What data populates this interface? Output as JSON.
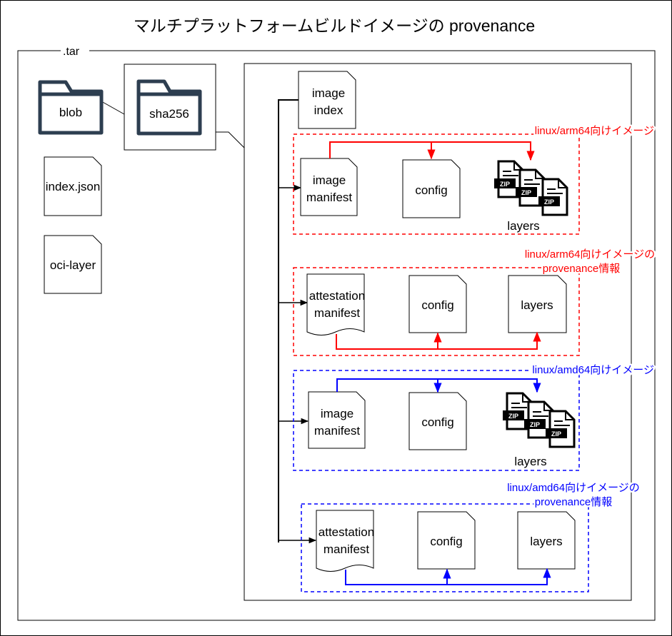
{
  "title": "マルチプラットフォームビルドイメージの provenance",
  "tar_label": ".tar",
  "colors": {
    "red": "#ff0000",
    "blue": "#0000ff",
    "black": "#000000",
    "folder": "#2d3e50"
  },
  "icons": {
    "folder": "folder-icon",
    "document": "document-icon",
    "zip": "zip-archive-icon"
  },
  "left": {
    "folders": [
      "blob",
      "sha256"
    ],
    "files": [
      "index.json",
      "oci-layer"
    ]
  },
  "image_index": {
    "line1": "image",
    "line2": "index"
  },
  "groups": [
    {
      "label": "linux/arm64向けイメージ",
      "color": "red",
      "manifest": {
        "line1": "image",
        "line2": "manifest"
      },
      "config": "config",
      "layers": "layers"
    },
    {
      "label": "linux/arm64向けイメージの",
      "label2": "provenance情報",
      "color": "red",
      "manifest": {
        "line1": "attestation",
        "line2": "manifest"
      },
      "config": "config",
      "layers": "layers"
    },
    {
      "label": "linux/amd64向けイメージ",
      "color": "blue",
      "manifest": {
        "line1": "image",
        "line2": "manifest"
      },
      "config": "config",
      "layers": "layers"
    },
    {
      "label": "linux/amd64向けイメージの",
      "label2": "provenance情報",
      "color": "blue",
      "manifest": {
        "line1": "attestation",
        "line2": "manifest"
      },
      "config": "config",
      "layers": "layers"
    }
  ]
}
